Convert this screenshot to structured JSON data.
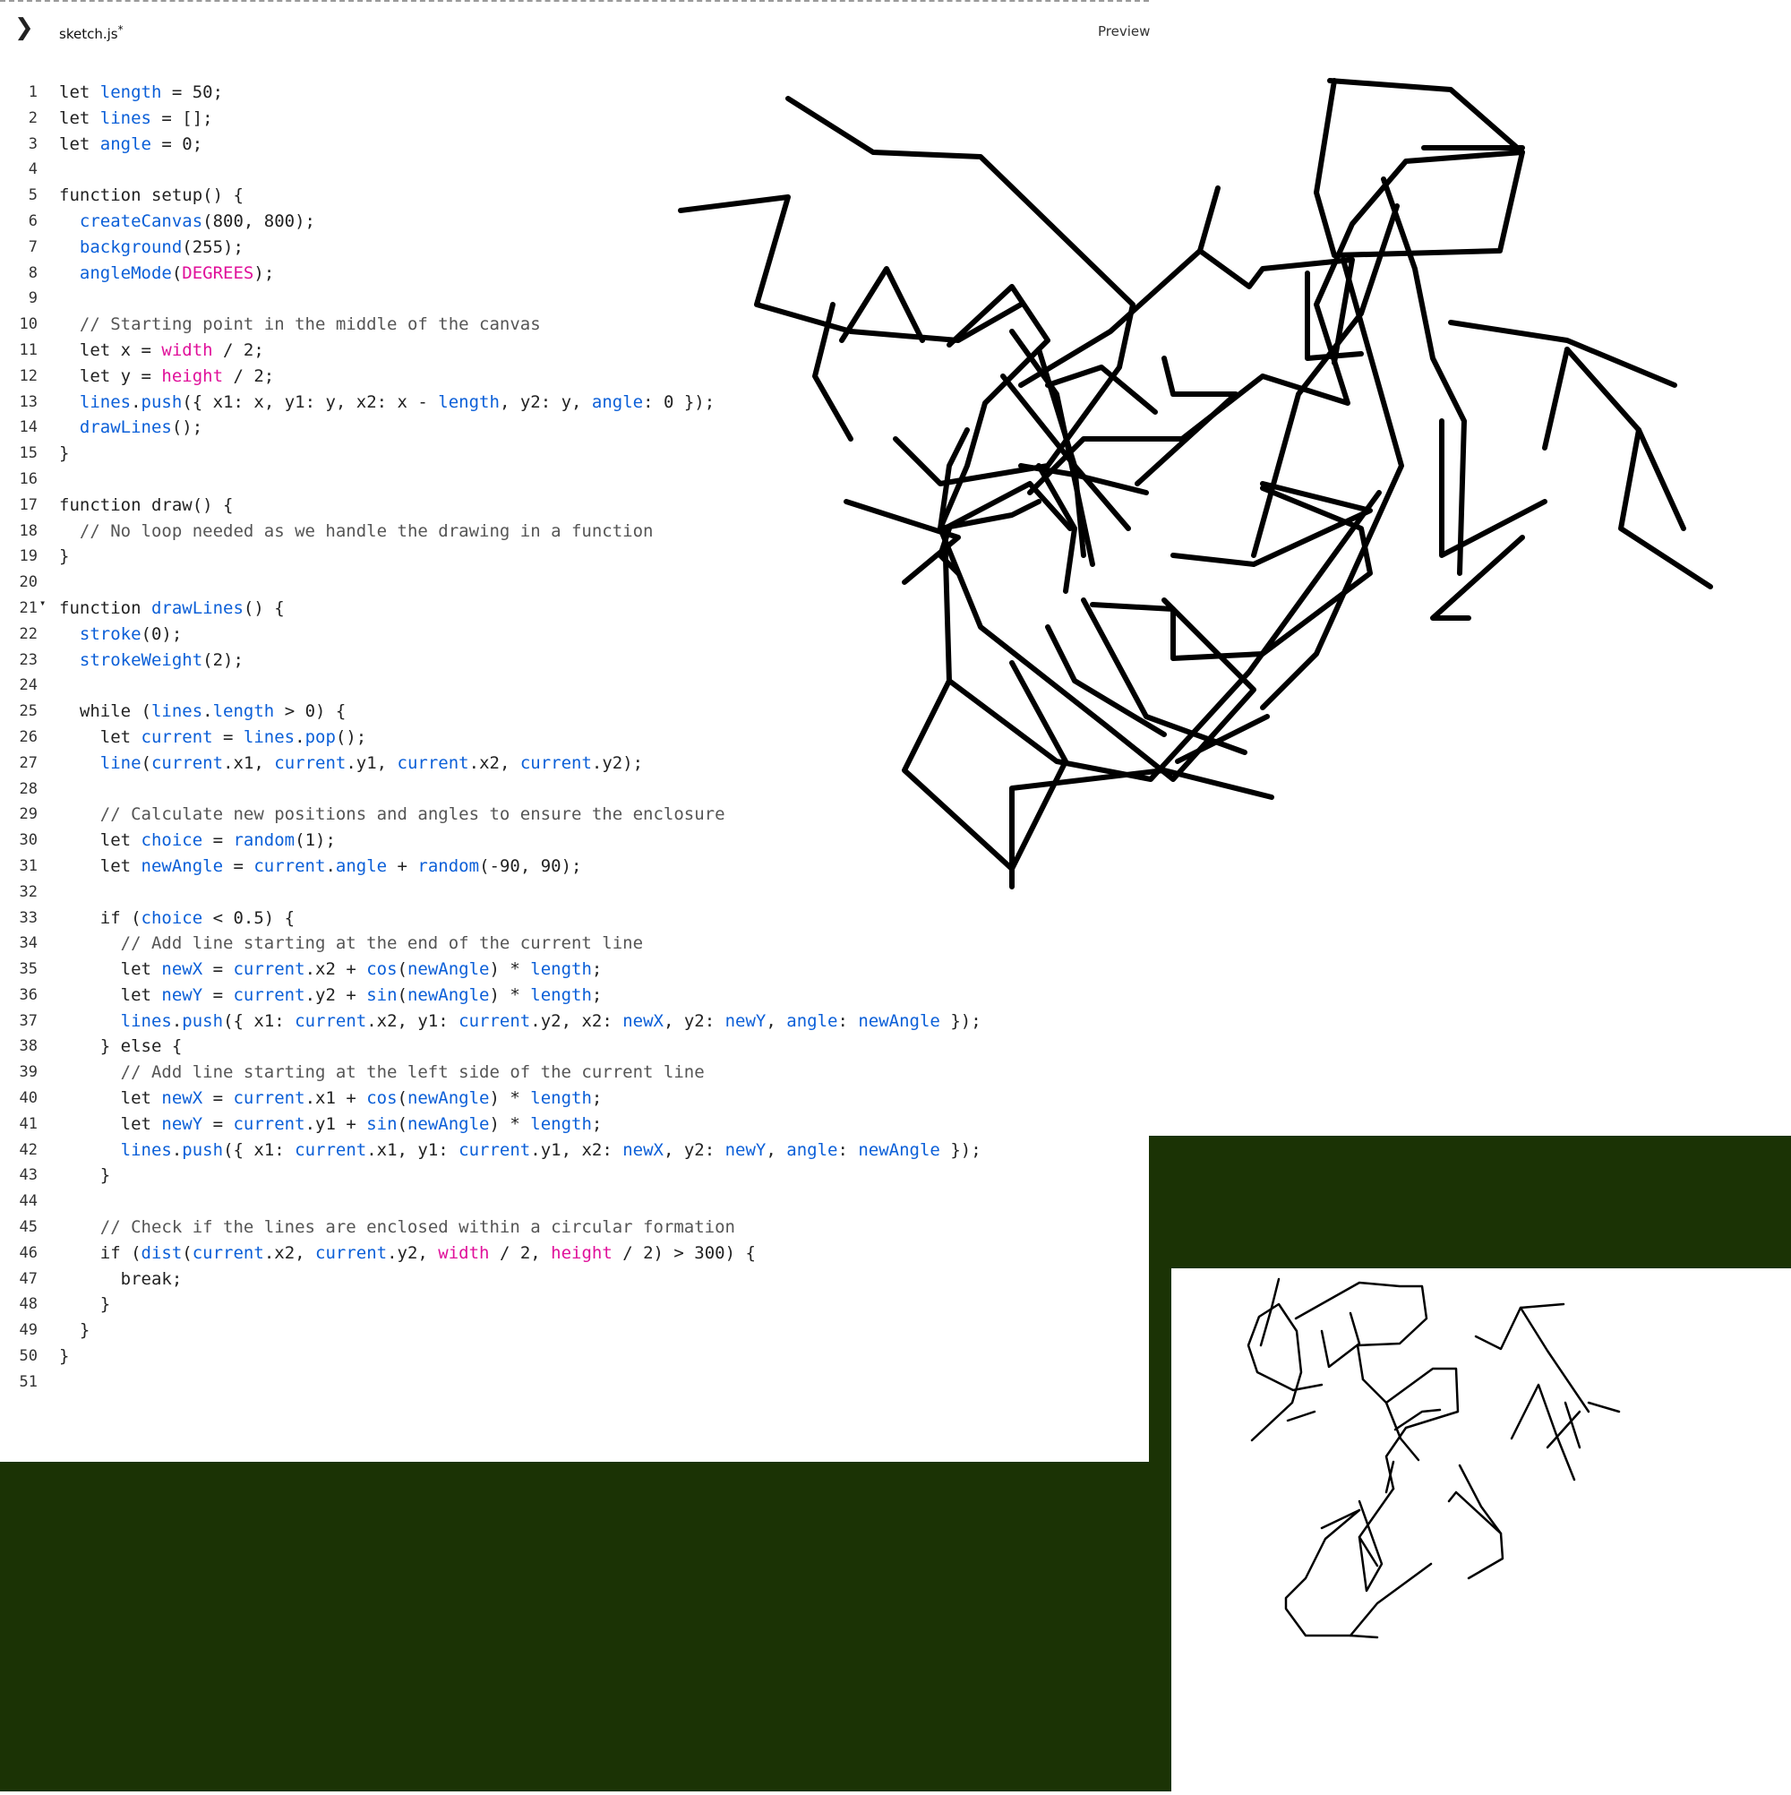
{
  "toolbar": {
    "file_name": "sketch.js",
    "unsaved_marker": "*",
    "preview_label": "Preview"
  },
  "colors": {
    "ground": "#1b3305",
    "keyword": "#222222",
    "variable": "#0b5fd8",
    "p5_builtin": "#e0109a",
    "comment": "#555555"
  },
  "code": {
    "lines": [
      "let length = 50;",
      "let lines = [];",
      "let angle = 0;",
      "",
      "function setup() {",
      "  createCanvas(800, 800);",
      "  background(255);",
      "  angleMode(DEGREES);",
      "",
      "  // Starting point in the middle of the canvas",
      "  let x = width / 2;",
      "  let y = height / 2;",
      "  lines.push({ x1: x, y1: y, x2: x - length, y2: y, angle: 0 });",
      "  drawLines();",
      "}",
      "",
      "function draw() {",
      "  // No loop needed as we handle the drawing in a function",
      "}",
      "",
      "function drawLines() {",
      "  stroke(0);",
      "  strokeWeight(2);",
      "",
      "  while (lines.length > 0) {",
      "    let current = lines.pop();",
      "    line(current.x1, current.y1, current.x2, current.y2);",
      "",
      "    // Calculate new positions and angles to ensure the enclosure",
      "    let choice = random(1);",
      "    let newAngle = current.angle + random(-90, 90);",
      "",
      "    if (choice < 0.5) {",
      "      // Add line starting at the end of the current line",
      "      let newX = current.x2 + cos(newAngle) * length;",
      "      let newY = current.y2 + sin(newAngle) * length;",
      "      lines.push({ x1: current.x2, y1: current.y2, x2: newX, y2: newY, angle: newAngle });",
      "    } else {",
      "      // Add line starting at the left side of the current line",
      "      let newX = current.x1 + cos(newAngle) * length;",
      "      let newY = current.y1 + sin(newAngle) * length;",
      "      lines.push({ x1: current.x1, y1: current.y1, x2: newX, y2: newY, angle: newAngle });",
      "    }",
      "",
      "    // Check if the lines are enclosed within a circular formation",
      "    if (dist(current.x2, current.y2, width / 2, height / 2) > 300) {",
      "      break;",
      "    }",
      "  }",
      "}",
      ""
    ],
    "fold_marker_line": 21,
    "fold_marker": "▾"
  }
}
